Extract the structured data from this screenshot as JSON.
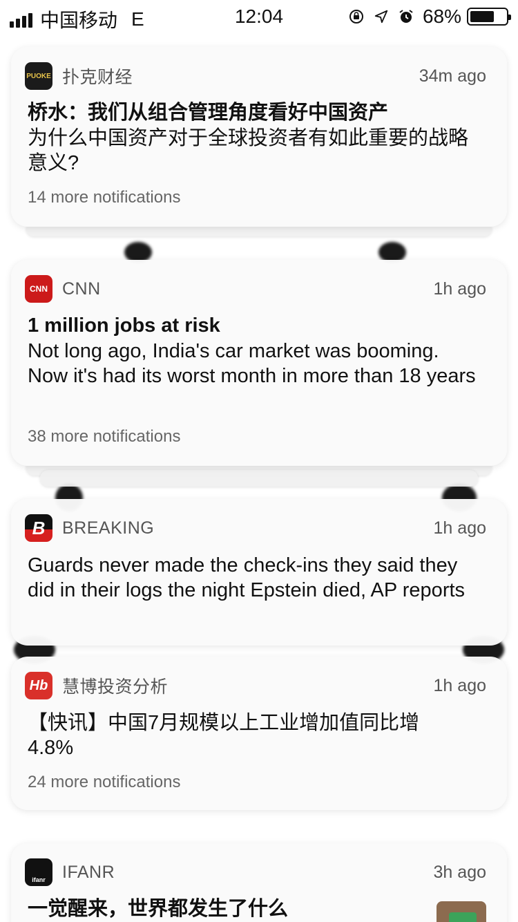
{
  "status_bar": {
    "carrier": "中国移动",
    "network": "E",
    "time": "12:04",
    "battery": "68%",
    "battery_level": 0.68
  },
  "notifications": [
    {
      "app": "扑克财经",
      "icon_text": "PUOKE",
      "icon_color": "#1b1b1b",
      "icon_text_color": "#e7c34a",
      "time": "34m ago",
      "title": "桥水：我们从组合管理角度看好中国资产",
      "text": "为什么中国资产对于全球投资者有如此重要的战略意义?",
      "more": "14 more notifications"
    },
    {
      "app": "CNN",
      "icon_text": "CNN",
      "icon_color": "#cc1a1a",
      "icon_text_color": "#ffffff",
      "time": "1h ago",
      "title": "1 million jobs at risk",
      "text": "Not long ago, India's car market was booming. Now it's had its worst month in more than 18 years",
      "more": "38 more notifications"
    },
    {
      "app": "BREAKING",
      "icon_text": "B",
      "icon_color": "#d6201f",
      "icon_text_color": "#ffffff",
      "time": "1h ago",
      "title": "",
      "text": "Guards never made the check-ins they said they did in their logs the night Epstein died, AP reports",
      "more": ""
    },
    {
      "app": "慧博投资分析",
      "icon_text": "Hb",
      "icon_color": "#d9302a",
      "icon_text_color": "#ffffff",
      "time": "1h ago",
      "title": "",
      "text": "【快讯】中国7月规模以上工业增加值同比增4.8%",
      "more": "24 more notifications"
    },
    {
      "app": "IFANR",
      "icon_text": "ifanr",
      "icon_color": "#111111",
      "icon_text_color": "#ffffff",
      "time": "3h ago",
      "title": "一觉醒来，世界都发生了什么",
      "text": "",
      "more": ""
    }
  ]
}
